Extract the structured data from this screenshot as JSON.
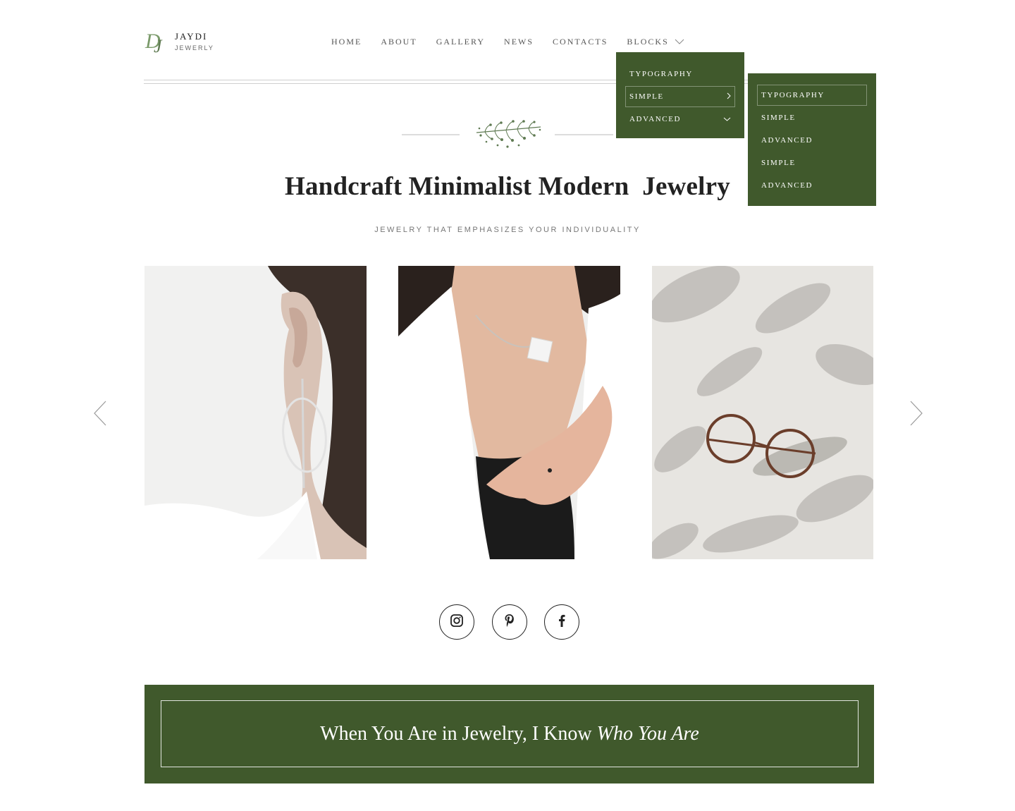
{
  "brand": {
    "name": "JAYDI",
    "subtitle": "JEWERLY",
    "accent": "#40592c",
    "logo_green": "#7a9a6a"
  },
  "nav": {
    "items": [
      "HOME",
      "ABOUT",
      "GALLERY",
      "NEWS",
      "CONTACTS",
      "BLOCKS"
    ]
  },
  "dropdown_primary": {
    "items": [
      {
        "label": "TYPOGRAPHY",
        "icon": ""
      },
      {
        "label": "SIMPLE",
        "icon": "chevron-right-icon"
      },
      {
        "label": "ADVANCED",
        "icon": "chevron-down-icon"
      }
    ]
  },
  "dropdown_secondary": {
    "items": [
      "TYPOGRAPHY",
      "SIMPLE",
      "ADVANCED",
      "SIMPLE",
      "ADVANCED"
    ]
  },
  "hero": {
    "title": "Handcraft Minimalist Modern  Jewelry",
    "subtitle": "JEWELRY THAT EMPHASIZES YOUR INDIVIDUALITY"
  },
  "gallery": {
    "images": [
      "earring-photo",
      "necklace-photo",
      "glasses-photo"
    ]
  },
  "social": [
    "instagram-icon",
    "pinterest-icon",
    "facebook-icon"
  ],
  "banner": {
    "text_plain": "When You Are in Jewelry, I Know ",
    "text_italic": "Who You Are"
  }
}
